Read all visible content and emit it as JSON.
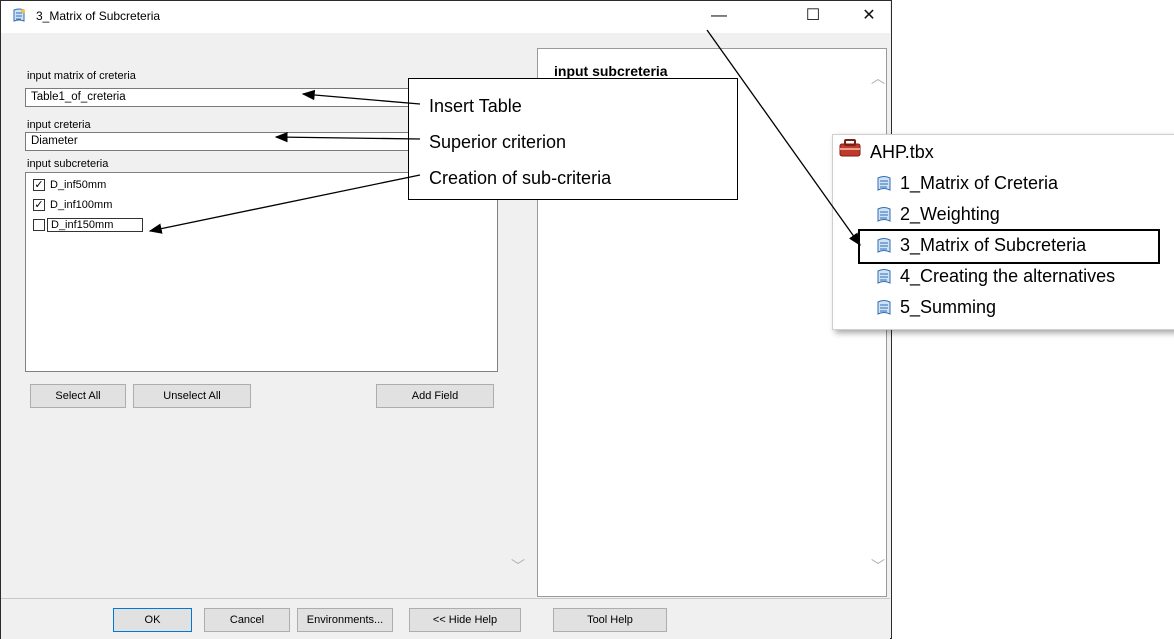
{
  "window": {
    "title": "3_Matrix of Subcreteria",
    "min_glyph": "—",
    "max_glyph": "☐",
    "close_glyph": "✕"
  },
  "form": {
    "matrix_label": "input matrix of creteria",
    "matrix_value": "Table1_of_creteria",
    "criteria_label": "input creteria",
    "criteria_value": "Diameter",
    "subcriteria_label": "input subcreteria",
    "subcriteria_items": [
      {
        "label": "D_inf50mm",
        "checked": true
      },
      {
        "label": "D_inf100mm",
        "checked": true
      },
      {
        "label": "D_inf150mm",
        "checked": false
      }
    ],
    "select_all": "Select All",
    "unselect_all": "Unselect All",
    "add_field": "Add Field"
  },
  "help": {
    "title": "input subcreteria"
  },
  "bottom_buttons": {
    "ok": "OK",
    "cancel": "Cancel",
    "environments": "Environments...",
    "hide_help": "<< Hide Help",
    "tool_help": "Tool Help"
  },
  "annotations": {
    "insert_table": "Insert Table",
    "superior_criterion": "Superior criterion",
    "creation_subcriteria": "Creation of sub-criteria"
  },
  "toolbox": {
    "name": "AHP.tbx",
    "tools": [
      "1_Matrix of Creteria",
      "2_Weighting",
      "3_Matrix of Subcreteria",
      "4_Creating the alternatives",
      "5_Summing"
    ]
  }
}
